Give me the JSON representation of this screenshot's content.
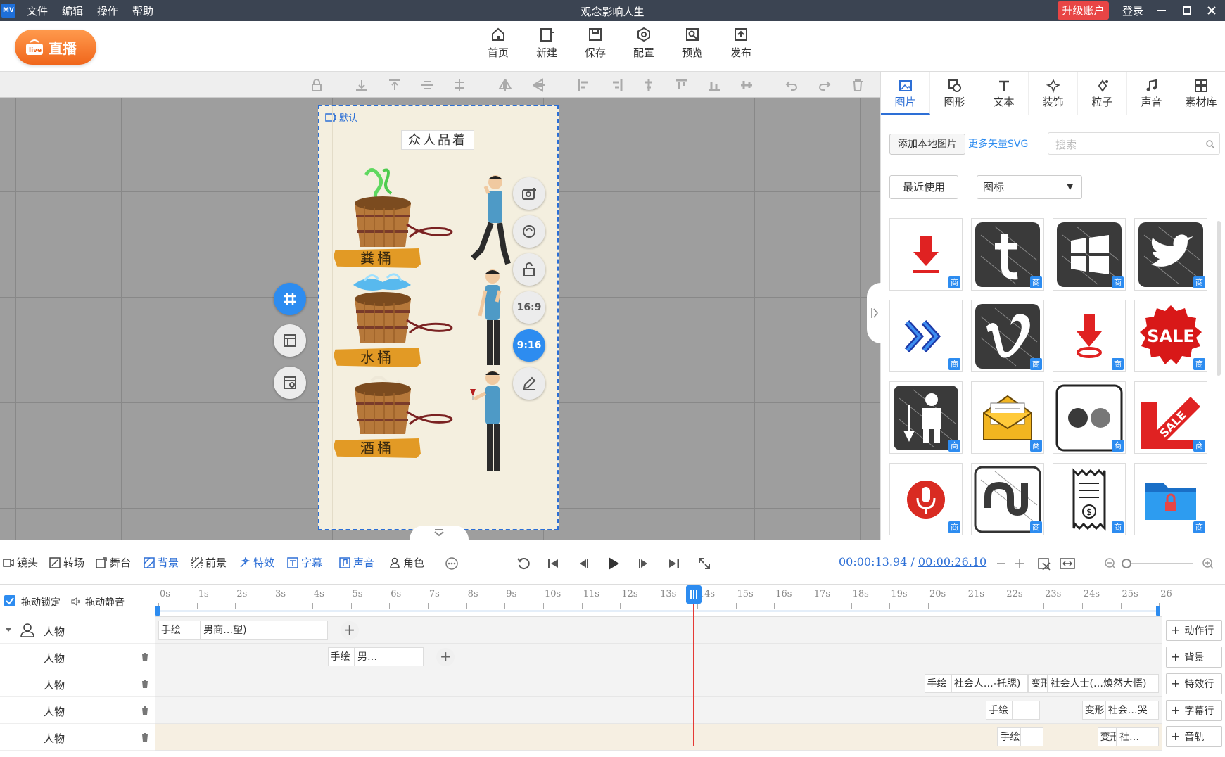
{
  "titlebar": {
    "logo": "MV",
    "menu": [
      "文件",
      "编辑",
      "操作",
      "帮助"
    ],
    "title": "观念影响人生",
    "upgrade": "升级账户",
    "login": "登录"
  },
  "toolbar": {
    "live": "直播",
    "items": [
      {
        "label": "首页",
        "icon": "home-icon"
      },
      {
        "label": "新建",
        "icon": "new-icon"
      },
      {
        "label": "保存",
        "icon": "save-icon"
      },
      {
        "label": "配置",
        "icon": "settings-icon"
      },
      {
        "label": "预览",
        "icon": "preview-icon"
      },
      {
        "label": "发布",
        "icon": "publish-icon"
      }
    ]
  },
  "stage": {
    "label": "默认",
    "title": "众人品着",
    "tags": [
      "粪桶",
      "水桶",
      "酒桶"
    ],
    "right_buttons": [
      "16:9",
      "9:16"
    ]
  },
  "panel": {
    "tabs": [
      "图片",
      "图形",
      "文本",
      "装饰",
      "粒子",
      "声音",
      "素材库"
    ],
    "add_local": "添加本地图片",
    "more_svg": "更多矢量SVG",
    "search_placeholder": "搜索",
    "recent": "最近使用",
    "category": "图标",
    "badge": "商",
    "icons": [
      "download-icon",
      "tumblr-icon",
      "windows-icon",
      "twitter-icon",
      "double-chevron-icon",
      "vimeo-icon",
      "download-pin-icon",
      "sale-badge-icon",
      "builder-icon",
      "mail-icon",
      "flickr-icon",
      "sale-arrow-icon",
      "microphone-icon",
      "stumbleupon-icon",
      "receipt-icon",
      "folder-lock-icon"
    ],
    "sale_text": "SALE"
  },
  "timeline_tools": {
    "items": [
      "镜头",
      "转场",
      "舞台",
      "背景",
      "前景",
      "特效",
      "字幕",
      "声音",
      "角色"
    ],
    "current_time": "00:00:13.94",
    "separator": "/",
    "total_time": "00:00:26.10"
  },
  "ruler": {
    "lock": "拖动锁定",
    "mute": "拖动静音",
    "ticks": [
      "0s",
      "1s",
      "2s",
      "3s",
      "4s",
      "5s",
      "6s",
      "7s",
      "8s",
      "9s",
      "10s",
      "11s",
      "12s",
      "13s",
      "14s",
      "15s",
      "16s",
      "17s",
      "18s",
      "19s",
      "20s",
      "21s",
      "22s",
      "23s",
      "24s",
      "25s",
      "26"
    ]
  },
  "tracks": [
    {
      "name": "人物",
      "clips": [
        {
          "text": "手绘",
          "start": 0.0,
          "end": 1.1
        },
        {
          "text": "男商…望)",
          "start": 1.1,
          "end": 4.4
        }
      ]
    },
    {
      "name": "人物",
      "clips": [
        {
          "text": "手绘",
          "start": 4.4,
          "end": 5.1
        },
        {
          "text": "男…",
          "start": 5.1,
          "end": 6.9
        }
      ]
    },
    {
      "name": "人物",
      "clips": [
        {
          "text": "手绘",
          "start": 19.9,
          "end": 20.6
        },
        {
          "text": "社会人…-托腮)",
          "start": 20.6,
          "end": 22.6
        },
        {
          "text": "变形",
          "start": 22.6,
          "end": 23.1
        },
        {
          "text": "社会人士(…焕然大悟)",
          "start": 23.1,
          "end": 26.0
        }
      ]
    },
    {
      "name": "人物",
      "clips": [
        {
          "text": "手绘",
          "start": 21.5,
          "end": 22.2
        },
        {
          "text": "",
          "start": 22.2,
          "end": 22.9
        },
        {
          "text": "变形",
          "start": 24.0,
          "end": 24.6
        },
        {
          "text": "社会…哭",
          "start": 24.6,
          "end": 26.0
        }
      ]
    },
    {
      "name": "人物",
      "clips": [
        {
          "text": "手绘",
          "start": 21.8,
          "end": 22.4
        },
        {
          "text": "",
          "start": 22.4,
          "end": 23.0
        },
        {
          "text": "变形",
          "start": 24.4,
          "end": 24.9
        },
        {
          "text": "社…",
          "start": 24.9,
          "end": 26.0
        }
      ]
    }
  ],
  "right_adds": [
    "动作行",
    "背景",
    "特效行",
    "字幕行",
    "音轨"
  ],
  "colors": {
    "accent": "#2d8cf0",
    "titlebar": "#3b4452",
    "upgrade": "#e84545",
    "live": "#f0661c",
    "playhead": "#e53935"
  }
}
